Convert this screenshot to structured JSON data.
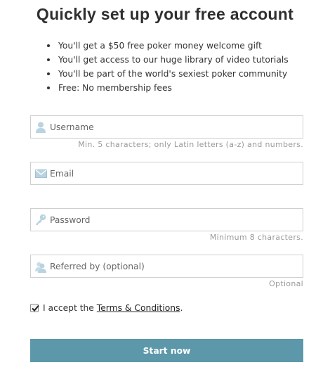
{
  "title": "Quickly set up your free account",
  "benefits": [
    "You'll get a $50 free poker money welcome gift",
    "You'll get access to our huge library of video tutorials",
    "You'll be part of the world's sexiest poker community",
    "Free: No membership fees"
  ],
  "fields": {
    "username": {
      "placeholder": "Username",
      "icon": "user-icon",
      "hint": "Min. 5 characters; only Latin letters (a-z) and numbers."
    },
    "email": {
      "placeholder": "Email",
      "icon": "envelope-icon"
    },
    "password": {
      "placeholder": "Password",
      "icon": "key-icon",
      "hint": "Minimum 8 characters."
    },
    "referred": {
      "placeholder": "Referred by (optional)",
      "icon": "users-icon",
      "hint": "Optional"
    }
  },
  "terms": {
    "checked": true,
    "prefix": "I accept the ",
    "link": "Terms & Conditions",
    "suffix": "."
  },
  "submit_label": "Start now",
  "colors": {
    "accent": "#5c98aa",
    "icon": "#b9d3e0"
  }
}
